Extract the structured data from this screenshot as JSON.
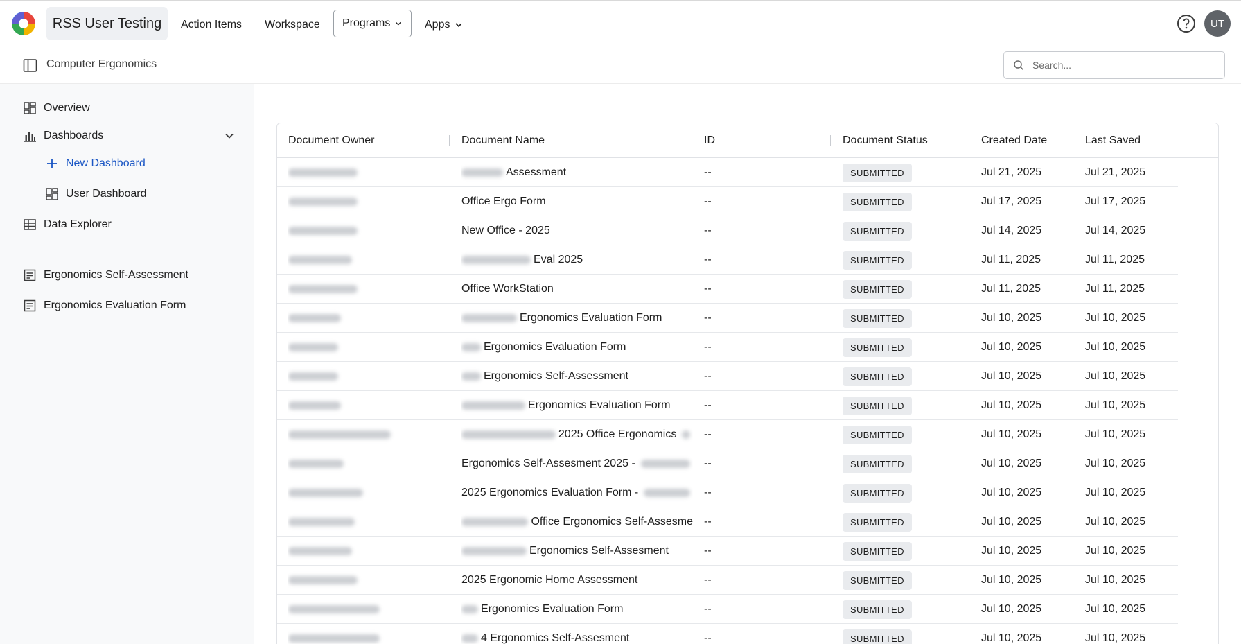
{
  "app": {
    "title": "RSS User Testing",
    "nav": [
      "Action Items",
      "Workspace",
      "Programs",
      "Apps"
    ],
    "avatar_initials": "UT"
  },
  "subheader": {
    "program_name": "Computer Ergonomics",
    "search_placeholder": "Search..."
  },
  "sidebar": {
    "items": [
      {
        "label": "Overview",
        "icon": "grid-icon"
      },
      {
        "label": "Dashboards",
        "icon": "bar-chart-icon"
      },
      {
        "label": "New Dashboard",
        "icon": "plus-icon"
      },
      {
        "label": "User Dashboard",
        "icon": "grid-icon"
      },
      {
        "label": "Data Explorer",
        "icon": "table-icon"
      },
      {
        "label": "Ergonomics Self-Assessment",
        "icon": "form-icon"
      },
      {
        "label": "Ergonomics Evaluation Form",
        "icon": "form-icon"
      }
    ]
  },
  "table": {
    "columns": [
      "Document Owner",
      "Document Name",
      "ID",
      "Document Status",
      "Created Date",
      "Last Saved"
    ],
    "rows": [
      {
        "name": "Assessment",
        "id": "--",
        "status": "SUBMITTED",
        "created": "Jul 21, 2025",
        "saved": "Jul 21, 2025"
      },
      {
        "name": "Office Ergo Form",
        "id": "--",
        "status": "SUBMITTED",
        "created": "Jul 17, 2025",
        "saved": "Jul 17, 2025"
      },
      {
        "name": "New Office - 2025",
        "id": "--",
        "status": "SUBMITTED",
        "created": "Jul 14, 2025",
        "saved": "Jul 14, 2025"
      },
      {
        "name": "Eval 2025",
        "id": "--",
        "status": "SUBMITTED",
        "created": "Jul 11, 2025",
        "saved": "Jul 11, 2025"
      },
      {
        "name": "Office WorkStation",
        "id": "--",
        "status": "SUBMITTED",
        "created": "Jul 11, 2025",
        "saved": "Jul 11, 2025"
      },
      {
        "name": "Ergonomics Evaluation Form",
        "id": "--",
        "status": "SUBMITTED",
        "created": "Jul 10, 2025",
        "saved": "Jul 10, 2025"
      },
      {
        "name": "Ergonomics Evaluation Form",
        "id": "--",
        "status": "SUBMITTED",
        "created": "Jul 10, 2025",
        "saved": "Jul 10, 2025"
      },
      {
        "name": "Ergonomics Self-Assessment",
        "id": "--",
        "status": "SUBMITTED",
        "created": "Jul 10, 2025",
        "saved": "Jul 10, 2025"
      },
      {
        "name": "Ergonomics Evaluation Form",
        "id": "--",
        "status": "SUBMITTED",
        "created": "Jul 10, 2025",
        "saved": "Jul 10, 2025"
      },
      {
        "name": "2025 Office Ergonomics",
        "id": "--",
        "status": "SUBMITTED",
        "created": "Jul 10, 2025",
        "saved": "Jul 10, 2025"
      },
      {
        "name": "Ergonomics Self-Assesment 2025 -",
        "id": "--",
        "status": "SUBMITTED",
        "created": "Jul 10, 2025",
        "saved": "Jul 10, 2025"
      },
      {
        "name": "2025 Ergonomics Evaluation Form -",
        "id": "--",
        "status": "SUBMITTED",
        "created": "Jul 10, 2025",
        "saved": "Jul 10, 2025"
      },
      {
        "name": "Office Ergonomics Self-Assesme",
        "id": "--",
        "status": "SUBMITTED",
        "created": "Jul 10, 2025",
        "saved": "Jul 10, 2025"
      },
      {
        "name": "Ergonomics Self-Assesment",
        "id": "--",
        "status": "SUBMITTED",
        "created": "Jul 10, 2025",
        "saved": "Jul 10, 2025"
      },
      {
        "name": "2025 Ergonomic Home Assessment",
        "id": "--",
        "status": "SUBMITTED",
        "created": "Jul 10, 2025",
        "saved": "Jul 10, 2025"
      },
      {
        "name": "Ergonomics Evaluation Form",
        "id": "--",
        "status": "SUBMITTED",
        "created": "Jul 10, 2025",
        "saved": "Jul 10, 2025"
      },
      {
        "name": "4 Ergonomics Self-Assesment",
        "id": "--",
        "status": "SUBMITTED",
        "created": "Jul 10, 2025",
        "saved": "Jul 10, 2025"
      }
    ]
  }
}
